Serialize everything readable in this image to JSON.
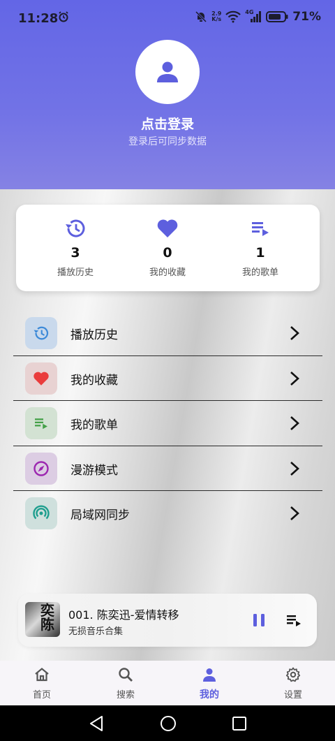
{
  "status_bar": {
    "time": "11:28",
    "net_speed_value": "2.9",
    "net_speed_unit": "K/s",
    "network": "4G",
    "battery": "71%"
  },
  "profile": {
    "login_title": "点击登录",
    "login_subtitle": "登录后可同步数据"
  },
  "stats": [
    {
      "value": "3",
      "label": "播放历史",
      "icon": "history-icon"
    },
    {
      "value": "0",
      "label": "我的收藏",
      "icon": "heart-icon"
    },
    {
      "value": "1",
      "label": "我的歌单",
      "icon": "playlist-icon"
    }
  ],
  "menu": [
    {
      "label": "播放历史",
      "icon": "history-icon"
    },
    {
      "label": "我的收藏",
      "icon": "heart-icon"
    },
    {
      "label": "我的歌单",
      "icon": "playlist-icon"
    },
    {
      "label": "漫游模式",
      "icon": "compass-icon"
    },
    {
      "label": "局域网同步",
      "icon": "broadcast-icon"
    }
  ],
  "player": {
    "song_title": "001. 陈奕迅-爱情转移",
    "album": "无损音乐合集",
    "cover_text": "奕陈"
  },
  "tabs": [
    {
      "label": "首页",
      "icon": "home-icon"
    },
    {
      "label": "搜索",
      "icon": "search-icon"
    },
    {
      "label": "我的",
      "icon": "person-icon",
      "active": true
    },
    {
      "label": "设置",
      "icon": "gear-icon"
    }
  ],
  "colors": {
    "accent": "#5d5fde",
    "header": "#6366e6",
    "heart": "#ea3c3c"
  }
}
